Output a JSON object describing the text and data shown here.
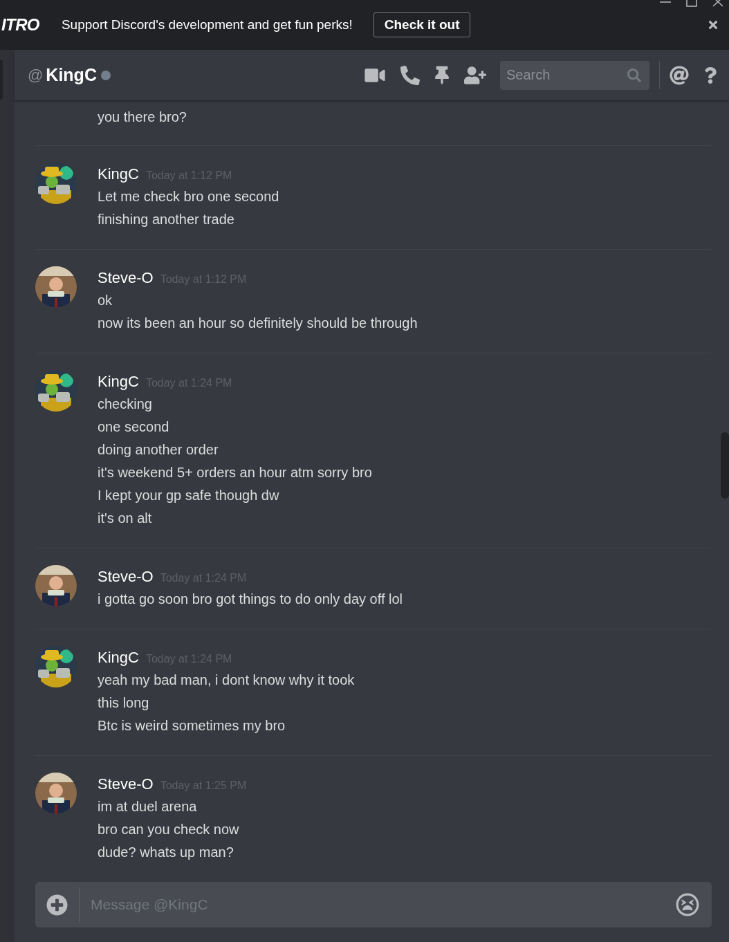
{
  "banner": {
    "logo": "ITRO",
    "text": "Support Discord's development and get fun perks!",
    "button": "Check it out"
  },
  "header": {
    "at": "@",
    "name": "KingC",
    "online": false,
    "search": {
      "placeholder": "Search"
    }
  },
  "messages": [
    {
      "kind": "continuation",
      "lines": [
        "you there bro?"
      ]
    },
    {
      "kind": "group",
      "author": "KingC",
      "time": "Today at 1:12 PM",
      "lines": [
        "Let me check bro one second",
        "finishing another trade"
      ]
    },
    {
      "kind": "group",
      "author": "Steve-O",
      "time": "Today at 1:12 PM",
      "lines": [
        "ok",
        "now its been an hour so definitely should be through"
      ]
    },
    {
      "kind": "group",
      "author": "KingC",
      "time": "Today at 1:24 PM",
      "lines": [
        "checking",
        "one second",
        "doing another order",
        "it's weekend 5+ orders an hour atm sorry bro",
        "I kept your gp safe though dw",
        "it's on alt"
      ]
    },
    {
      "kind": "group",
      "author": "Steve-O",
      "time": "Today at 1:24 PM",
      "lines": [
        "i gotta go soon bro got things to do only day off lol"
      ]
    },
    {
      "kind": "group",
      "author": "KingC",
      "time": "Today at 1:24 PM",
      "lines": [
        "yeah my bad man, i dont know why it took",
        "this long",
        "Btc is weird sometimes my bro"
      ]
    },
    {
      "kind": "group",
      "author": "Steve-O",
      "time": "Today at 1:25 PM",
      "lines": [
        "im at duel arena",
        "bro can you check now",
        "dude? whats up man?"
      ]
    }
  ],
  "composer": {
    "placeholder": "Message @KingC"
  }
}
